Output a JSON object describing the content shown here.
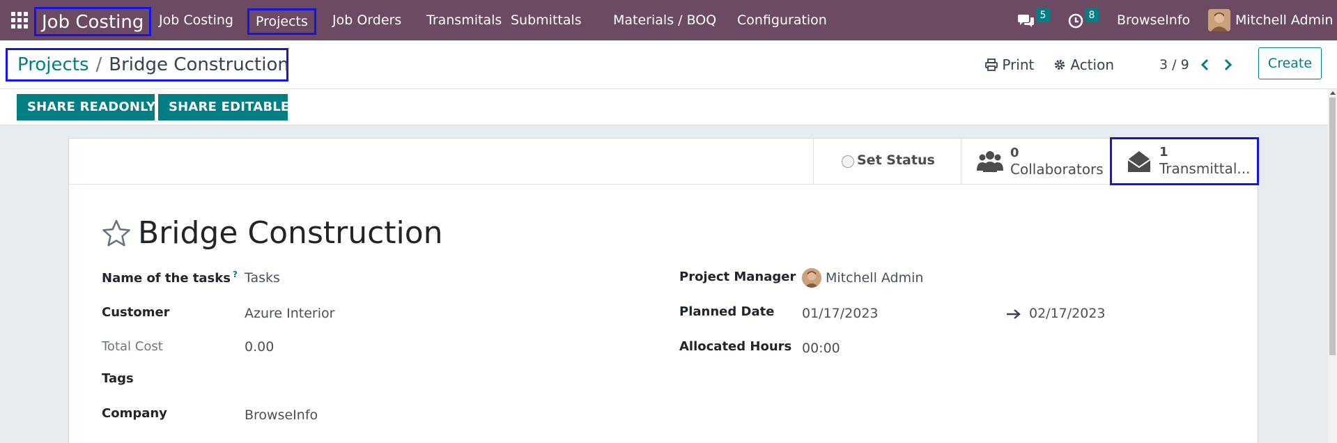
{
  "navbar": {
    "brand": "Job Costing",
    "menu": [
      "Job Costing",
      "Projects",
      "Job Orders",
      "Transmitals",
      "Submittals",
      "Materials / BOQ",
      "Configuration"
    ],
    "messages_count": "5",
    "activities_count": "8",
    "company": "BrowseInfo",
    "user": "Mitchell Admin"
  },
  "breadcrumb": {
    "parent": "Projects",
    "separator": "/",
    "current": "Bridge Construction"
  },
  "control": {
    "print": "Print",
    "action": "Action",
    "pager": "3 / 9",
    "create": "Create"
  },
  "statusbar": {
    "share_readonly": "SHARE READONLY",
    "share_editable": "SHARE EDITABLE"
  },
  "button_box": {
    "set_status": "Set Status",
    "collaborators_count": "0",
    "collaborators_label": "Collaborators",
    "transmittals_count": "1",
    "transmittals_label": "Transmittal..."
  },
  "form": {
    "title": "Bridge Construction",
    "tasks_label": "Name of the tasks",
    "tasks_help": "?",
    "tasks_value": "Tasks",
    "customer_label": "Customer",
    "customer_value": "Azure Interior",
    "total_cost_label": "Total Cost",
    "total_cost_value": "0.00",
    "tags_label": "Tags",
    "company_label": "Company",
    "company_value": "BrowseInfo",
    "manager_label": "Project Manager",
    "manager_value": "Mitchell Admin",
    "planned_label": "Planned Date",
    "planned_start": "01/17/2023",
    "planned_end": "02/17/2023",
    "allocated_label": "Allocated Hours",
    "allocated_value": "00:00"
  },
  "colors": {
    "navbar": "#6c4a64",
    "accent": "#017e84",
    "highlight_box": "#1414e6"
  }
}
